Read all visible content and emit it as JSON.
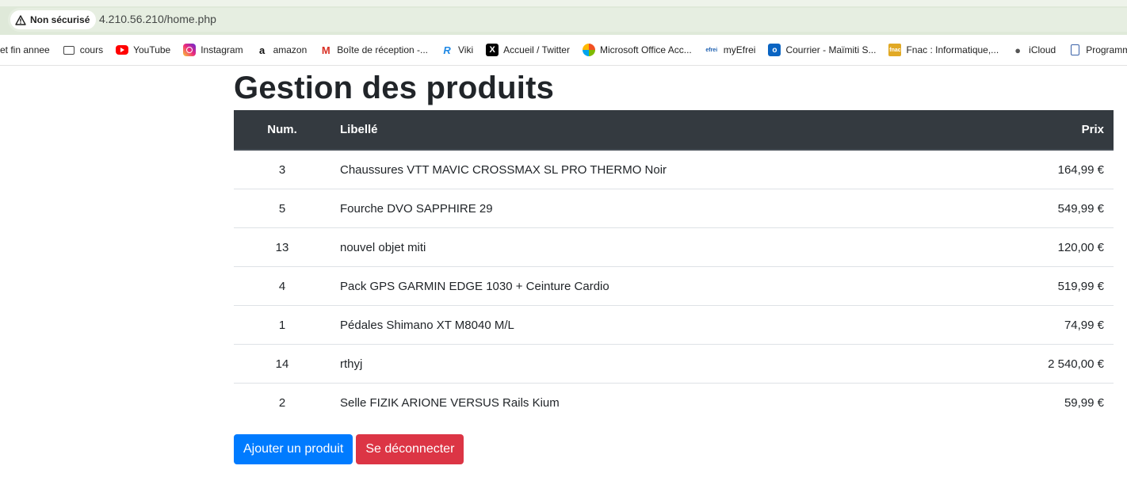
{
  "browser": {
    "security_label": "Non sécurisé",
    "url": "4.210.56.210/home.php",
    "bookmarks": [
      {
        "label": "et fin annee",
        "icon": "none"
      },
      {
        "label": "cours",
        "icon": "folder-icon"
      },
      {
        "label": "YouTube",
        "icon": "youtube-icon"
      },
      {
        "label": "Instagram",
        "icon": "instagram-icon"
      },
      {
        "label": "amazon",
        "icon": "amazon-icon"
      },
      {
        "label": "Boîte de réception -...",
        "icon": "gmail-icon"
      },
      {
        "label": "Viki",
        "icon": "viki-icon"
      },
      {
        "label": "Accueil / Twitter",
        "icon": "x-twitter-icon"
      },
      {
        "label": "Microsoft Office Acc...",
        "icon": "microsoft-office-icon"
      },
      {
        "label": "myEfrei",
        "icon": "efrei-icon"
      },
      {
        "label": "Courrier - Maïmiti S...",
        "icon": "outlook-icon"
      },
      {
        "label": "Fnac : Informatique,...",
        "icon": "fnac-icon"
      },
      {
        "label": "iCloud",
        "icon": "apple-icon"
      },
      {
        "label": "Programm",
        "icon": "document-icon"
      }
    ],
    "icon_glyphs": {
      "amazon": "a",
      "gmail": "M",
      "viki": "R",
      "x": "X",
      "efrei": "efrei",
      "outlook": "o",
      "fnac": "fnac",
      "apple": "●"
    }
  },
  "page": {
    "title": "Gestion des produits",
    "table": {
      "headers": {
        "num": "Num.",
        "label": "Libellé",
        "price": "Prix"
      },
      "rows": [
        {
          "num": "3",
          "label": "Chaussures VTT MAVIC CROSSMAX SL PRO THERMO Noir",
          "price": "164,99 €"
        },
        {
          "num": "5",
          "label": "Fourche DVO SAPPHIRE 29",
          "price": "549,99 €"
        },
        {
          "num": "13",
          "label": "nouvel objet miti",
          "price": "120,00 €"
        },
        {
          "num": "4",
          "label": "Pack GPS GARMIN EDGE 1030 + Ceinture Cardio",
          "price": "519,99 €"
        },
        {
          "num": "1",
          "label": "Pédales Shimano XT M8040 M/L",
          "price": "74,99 €"
        },
        {
          "num": "14",
          "label": "rthyj",
          "price": "2 540,00 €"
        },
        {
          "num": "2",
          "label": "Selle FIZIK ARIONE VERSUS Rails Kium",
          "price": "59,99 €"
        }
      ]
    },
    "buttons": {
      "add": "Ajouter un produit",
      "logout": "Se déconnecter"
    }
  },
  "colors": {
    "table_header": "#343a40",
    "primary": "#007bff",
    "danger": "#dc3545"
  }
}
